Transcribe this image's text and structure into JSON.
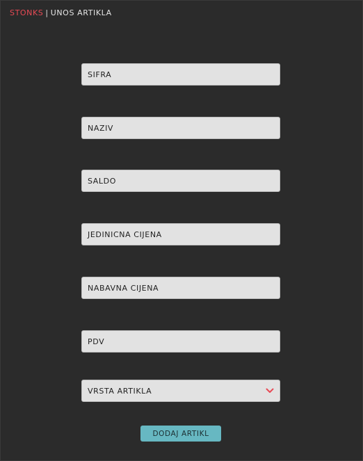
{
  "header": {
    "brand": "STONKS",
    "separator": "|",
    "title": "UNOS ARTIKLA"
  },
  "form": {
    "fields": [
      {
        "placeholder": "SIFRA"
      },
      {
        "placeholder": "NAZIV"
      },
      {
        "placeholder": "SALDO"
      },
      {
        "placeholder": "JEDINICNA CIJENA"
      },
      {
        "placeholder": "NABAVNA CIJENA"
      },
      {
        "placeholder": "PDV"
      }
    ],
    "select": {
      "selected": "VRSTA ARTIKLA",
      "icon": "chevron-down-icon",
      "icon_color": "#e84a55"
    },
    "submit_label": "DODAJ ARTIKL"
  },
  "colors": {
    "background": "#2b2b2b",
    "brand": "#e84a55",
    "field": "#e2e2e2",
    "button": "#67b8c2"
  }
}
